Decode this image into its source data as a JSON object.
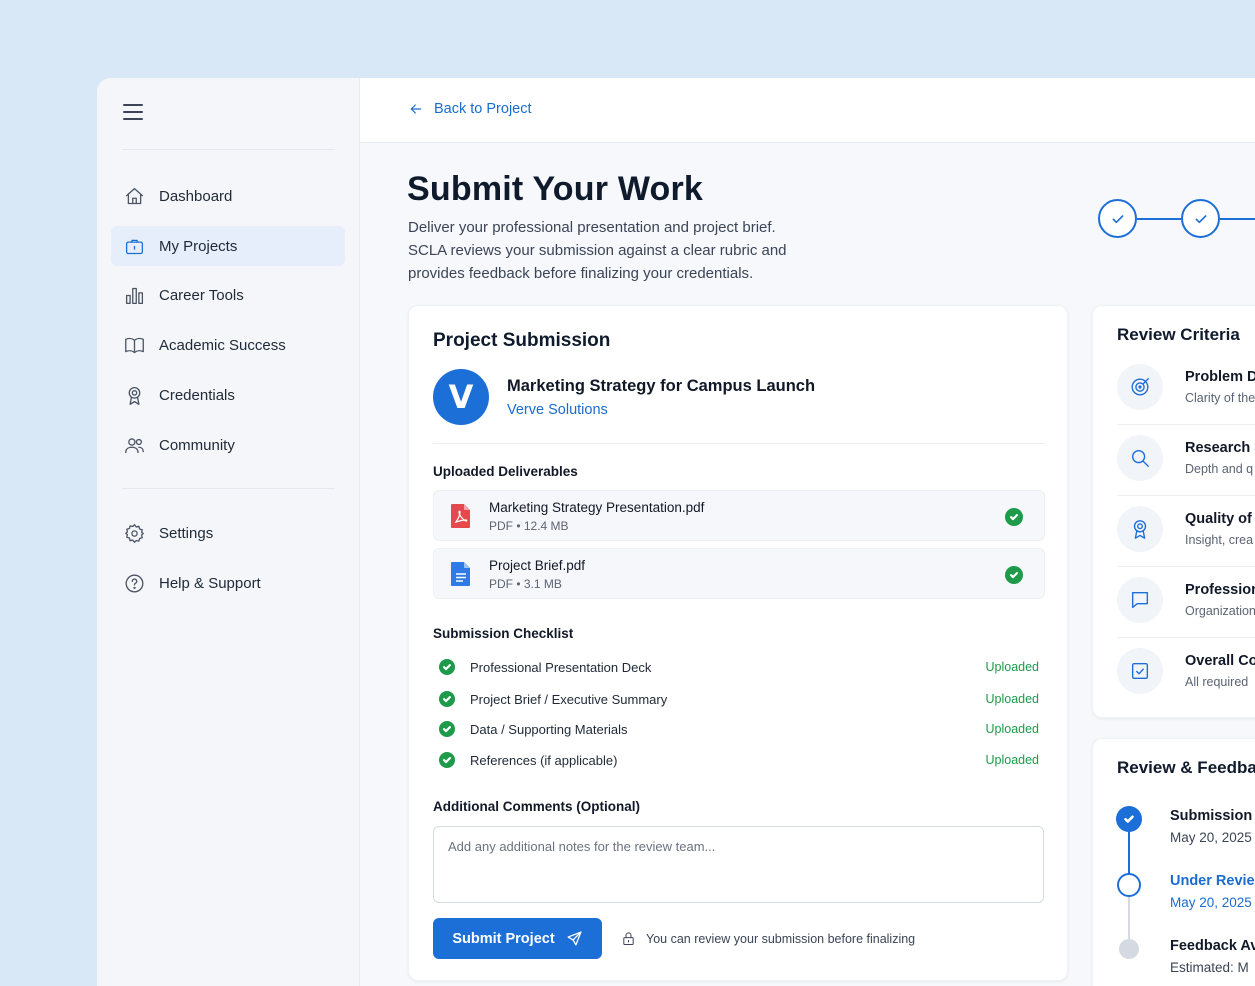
{
  "sidebar": {
    "items": [
      {
        "label": "Dashboard",
        "icon": "home-icon"
      },
      {
        "label": "My Projects",
        "icon": "briefcase-icon",
        "active": true
      },
      {
        "label": "Career Tools",
        "icon": "bar-chart-icon"
      },
      {
        "label": "Academic Success",
        "icon": "book-icon"
      },
      {
        "label": "Credentials",
        "icon": "award-icon"
      },
      {
        "label": "Community",
        "icon": "users-icon"
      }
    ],
    "bottom_items": [
      {
        "label": "Settings",
        "icon": "gear-icon"
      },
      {
        "label": "Help & Support",
        "icon": "help-circle-icon"
      }
    ]
  },
  "header": {
    "back_label": "Back to Project"
  },
  "page": {
    "title": "Submit Your Work",
    "description": "Deliver your professional presentation and project brief. SCLA reviews your submission against a clear rubric and provides feedback before finalizing your credentials."
  },
  "submission": {
    "title": "Project Submission",
    "logo_letter": "V",
    "project_name": "Marketing Strategy for Campus Launch",
    "company": "Verve Solutions",
    "deliverables_label": "Uploaded Deliverables",
    "files": [
      {
        "name": "Marketing Strategy Presentation.pdf",
        "meta": "PDF • 12.4 MB",
        "icon": "pdf-file-icon"
      },
      {
        "name": "Project Brief.pdf",
        "meta": "PDF • 3.1 MB",
        "icon": "document-file-icon"
      }
    ],
    "checklist_label": "Submission Checklist",
    "checklist": [
      {
        "label": "Professional Presentation Deck",
        "status": "Uploaded"
      },
      {
        "label": "Project Brief / Executive Summary",
        "status": "Uploaded"
      },
      {
        "label": "Data / Supporting Materials",
        "status": "Uploaded"
      },
      {
        "label": "References (if applicable)",
        "status": "Uploaded"
      }
    ],
    "comments_label": "Additional Comments (Optional)",
    "comments_placeholder": "Add any additional notes for the review team...",
    "submit_label": "Submit Project",
    "lock_note": "You can review your submission before finalizing"
  },
  "criteria": {
    "title": "Review Criteria",
    "items": [
      {
        "name": "Problem D",
        "desc": "Clarity of the",
        "icon": "target-icon"
      },
      {
        "name": "Research a",
        "desc": "Depth and q",
        "icon": "search-icon"
      },
      {
        "name": "Quality of",
        "desc": "Insight, crea",
        "icon": "award-icon"
      },
      {
        "name": "Profession",
        "desc": "Organization",
        "icon": "chat-bubble-icon"
      },
      {
        "name": "Overall Co",
        "desc": "All required",
        "icon": "checkbox-icon"
      }
    ]
  },
  "feedback": {
    "title": "Review & Feedbac",
    "steps": [
      {
        "name": "Submission I",
        "date": "May 20, 2025",
        "state": "done"
      },
      {
        "name": "Under Revie",
        "date": "May 20, 2025",
        "state": "current"
      },
      {
        "name": "Feedback Av",
        "date": "Estimated: M",
        "state": "pending"
      }
    ]
  },
  "colors": {
    "accent": "#1d6fd8",
    "success": "#1f9a4a",
    "background": "#d8e8f7"
  }
}
